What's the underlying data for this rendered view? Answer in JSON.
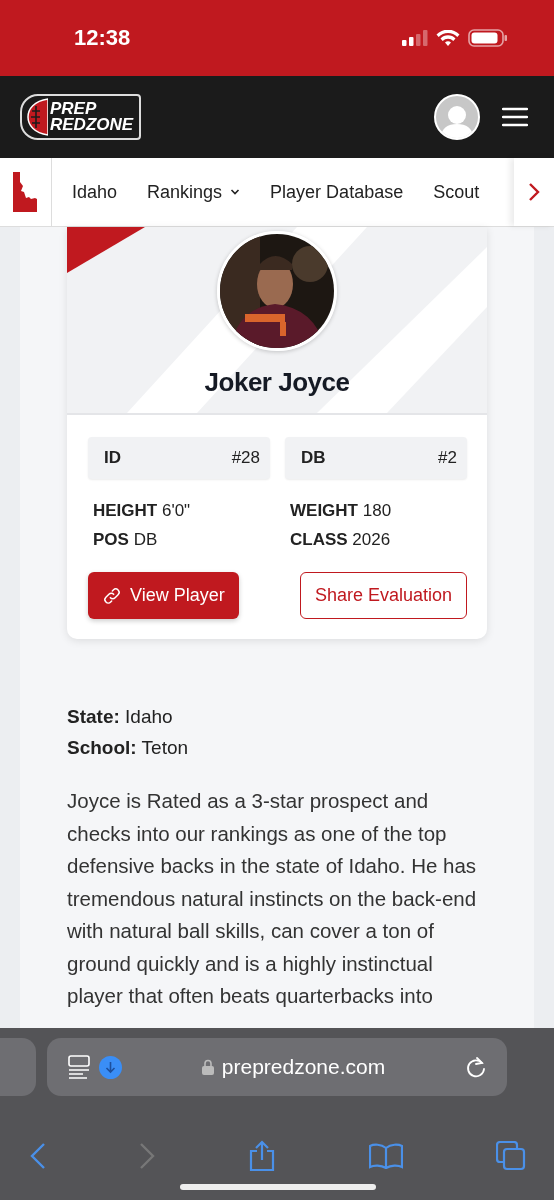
{
  "status_bar": {
    "time": "12:38"
  },
  "header": {
    "logo_top": "PREP",
    "logo_bottom": "REDZONE"
  },
  "nav": {
    "items": [
      {
        "label": "Idaho",
        "has_menu": false
      },
      {
        "label": "Rankings",
        "has_menu": true
      },
      {
        "label": "Player Database",
        "has_menu": false
      },
      {
        "label": "Scout",
        "has_menu": false
      }
    ]
  },
  "player": {
    "name": "Joker Joyce",
    "ranks": [
      {
        "label": "ID",
        "value": "#28"
      },
      {
        "label": "DB",
        "value": "#2"
      }
    ],
    "details": [
      {
        "label": "HEIGHT",
        "value": "6'0\""
      },
      {
        "label": "WEIGHT",
        "value": "180"
      },
      {
        "label": "POS",
        "value": "DB"
      },
      {
        "label": "CLASS",
        "value": "2026"
      }
    ],
    "buttons": [
      {
        "label": "View Player",
        "kind": "primary"
      },
      {
        "label": "Share Evaluation",
        "kind": "outline"
      }
    ]
  },
  "info": [
    {
      "label": "State:",
      "value": "Idaho"
    },
    {
      "label": "School:",
      "value": "Teton"
    }
  ],
  "evaluation": "Joyce is Rated as a 3-star prospect and checks into our rankings as one of the top defensive backs in the state of Idaho. He has tremendous natural instincts on the back-end with natural ball skills, can cover a ton of ground quickly and is a highly instinctual player that often beats quarterbacks into",
  "browser": {
    "url": "prepredzone.com"
  }
}
